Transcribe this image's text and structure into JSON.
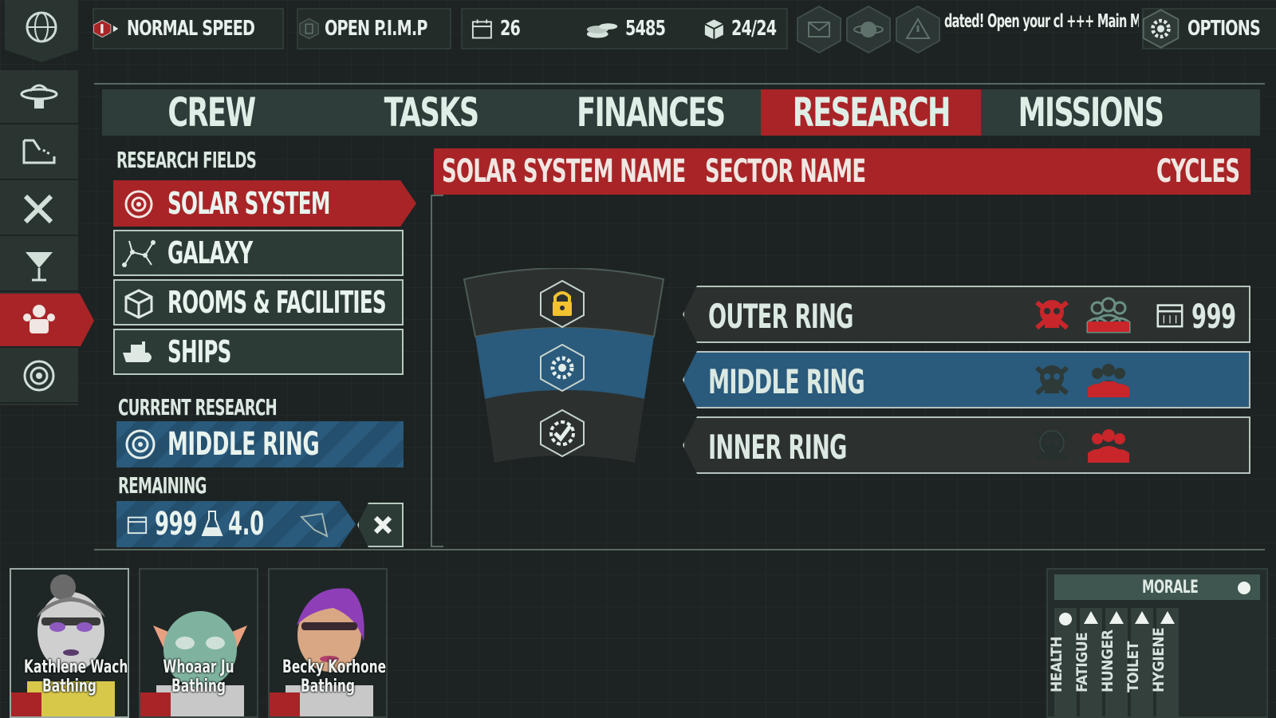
{
  "topbar": {
    "speed_label": "NORMAL SPEED",
    "pimp_label": "OPEN P.I.M.P",
    "day": "26",
    "money": "5485",
    "capacity": "24/24",
    "ticker": "dated! Open your cl +++ Main Missi",
    "options_label": "OPTIONS"
  },
  "tabs": [
    {
      "label": "CREW",
      "active": false
    },
    {
      "label": "TASKS",
      "active": false
    },
    {
      "label": "FINANCES",
      "active": false
    },
    {
      "label": "RESEARCH",
      "active": true
    },
    {
      "label": "MISSIONS",
      "active": false
    }
  ],
  "research": {
    "fields_title": "RESEARCH FIELDS",
    "fields": [
      {
        "label": "SOLAR SYSTEM",
        "icon": "orbit-icon",
        "active": true
      },
      {
        "label": "GALAXY",
        "icon": "constellation-icon",
        "active": false
      },
      {
        "label": "ROOMS & FACILITIES",
        "icon": "cube-icon",
        "active": false
      },
      {
        "label": "SHIPS",
        "icon": "ship-icon",
        "active": false
      }
    ],
    "current_title": "CURRENT RESEARCH",
    "current": "MIDDLE RING",
    "remaining_title": "REMAINING",
    "remaining_cycles": "999",
    "remaining_science": "4.0"
  },
  "table": {
    "col_system": "SOLAR SYSTEM NAME",
    "col_sector": "SECTOR NAME",
    "col_cycles": "CYCLES",
    "rings": [
      {
        "name": "OUTER RING",
        "cycles": "999",
        "selected": false,
        "skull_color": "#c8262a",
        "crew_fill": 0.3
      },
      {
        "name": "MIDDLE RING",
        "cycles": "",
        "selected": true,
        "skull_color": "#2d3a37",
        "crew_fill": 0.6
      },
      {
        "name": "INNER RING",
        "cycles": "",
        "selected": false,
        "skull_color": "#2d3a37",
        "crew_fill": 1.0
      }
    ]
  },
  "crew": [
    {
      "name": "Kathlene Wachowia",
      "status": "Bathing"
    },
    {
      "name": "Whoaar Ju",
      "status": "Bathing"
    },
    {
      "name": "Becky Korhonen",
      "status": "Bathing"
    }
  ],
  "morale": {
    "title": "MORALE",
    "stats": [
      "HEALTH",
      "FATIGUE",
      "HUNGER",
      "TOILET",
      "HYGIENE"
    ]
  },
  "colors": {
    "accent_red": "#a82427",
    "accent_blue": "#2a5a7c",
    "panel": "#2e3d39"
  }
}
